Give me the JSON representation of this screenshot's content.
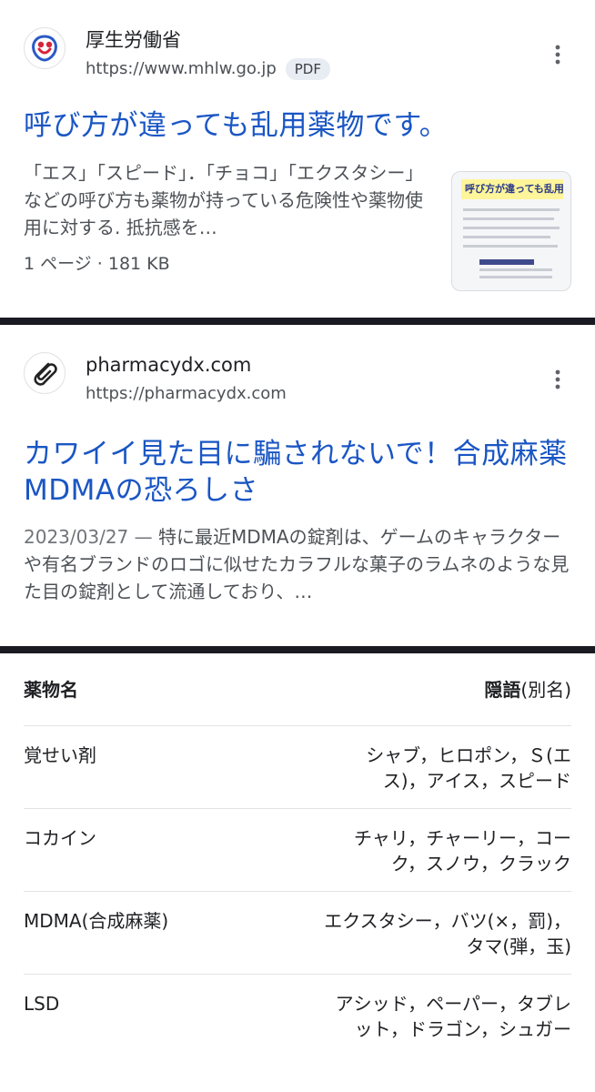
{
  "results": [
    {
      "site_name": "厚生労働省",
      "url": "https://www.mhlw.go.jp",
      "badge": "PDF",
      "title": "呼び方が違っても乱用薬物です。",
      "snippet": "「エス」「スピード」．「チョコ」「エクスタシー」などの呼び方も薬物が持っている危険性や薬物使用に対する. 抵抗感を…",
      "meta": "1 ページ · 181 KB",
      "thumbnail_text": "呼び方が違っても乱用"
    },
    {
      "site_name": "pharmacydx.com",
      "url": "https://pharmacydx.com",
      "title": "カワイイ見た目に騙されないで！合成麻薬MDMAの恐ろしさ",
      "date": "2023/03/27",
      "snippet": "特に最近MDMAの錠剤は、ゲームのキャラクターや有名ブランドのロゴに似せたカラフルな菓子のラムネのような見た目の錠剤として流通しており、…"
    }
  ],
  "table": {
    "headers": {
      "drug": "薬物名",
      "slang_bold": "隠語",
      "slang_rest": "(別名)"
    },
    "rows": [
      {
        "drug": "覚せい剤",
        "slang": "シャブ，ヒロポン，Ｓ(エス)，アイス，スピード"
      },
      {
        "drug": "コカイン",
        "slang": "チャリ，チャーリー，コーク，スノウ，クラック"
      },
      {
        "drug": "MDMA(合成麻薬)",
        "slang": "エクスタシー，バツ(×，罰)，タマ(弾，玉)"
      },
      {
        "drug": "LSD",
        "slang": "アシッド，ペーパー，タブレット，ドラゴン，シュガー"
      }
    ]
  },
  "icons": {
    "result1_favicon": "mhlw-logo-icon",
    "result2_favicon": "paperclip-icon",
    "menu": "more-vert-icon"
  },
  "colors": {
    "link": "#1a56c4",
    "divider": "#1a1a22"
  }
}
